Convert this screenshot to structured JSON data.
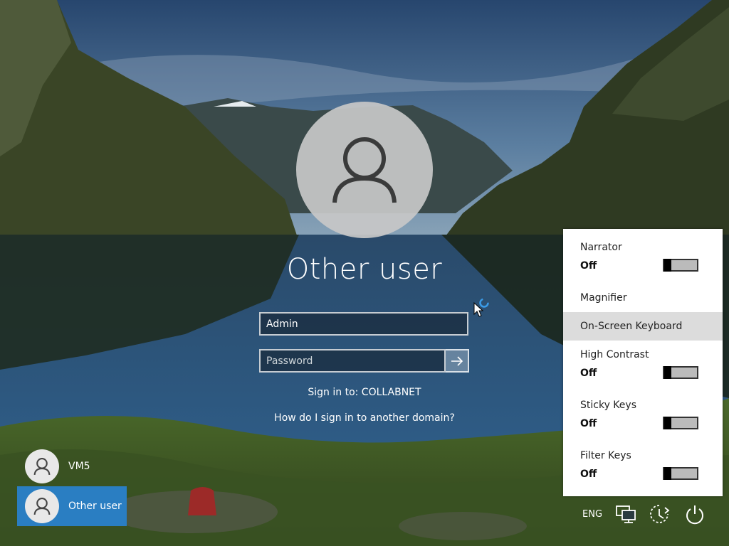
{
  "login": {
    "title": "Other user",
    "username_value": "Admin",
    "password_placeholder": "Password",
    "sign_in_to": "Sign in to: COLLABNET",
    "domain_help": "How do I sign in to another domain?"
  },
  "users": [
    {
      "name": "VM5",
      "selected": false
    },
    {
      "name": "Other user",
      "selected": true
    }
  ],
  "ease_of_access": {
    "narrator": {
      "label": "Narrator",
      "state": "Off"
    },
    "magnifier": {
      "label": "Magnifier"
    },
    "on_screen_keyboard": {
      "label": "On-Screen Keyboard"
    },
    "high_contrast": {
      "label": "High Contrast",
      "state": "Off"
    },
    "sticky_keys": {
      "label": "Sticky Keys",
      "state": "Off"
    },
    "filter_keys": {
      "label": "Filter Keys",
      "state": "Off"
    }
  },
  "tray": {
    "language": "ENG",
    "icons": [
      "network-icon",
      "ease-of-access-icon",
      "power-icon"
    ]
  },
  "colors": {
    "selected_user": "#2a7ec2",
    "panel_bg": "#ffffff",
    "panel_highlight": "#dcdcdc"
  }
}
